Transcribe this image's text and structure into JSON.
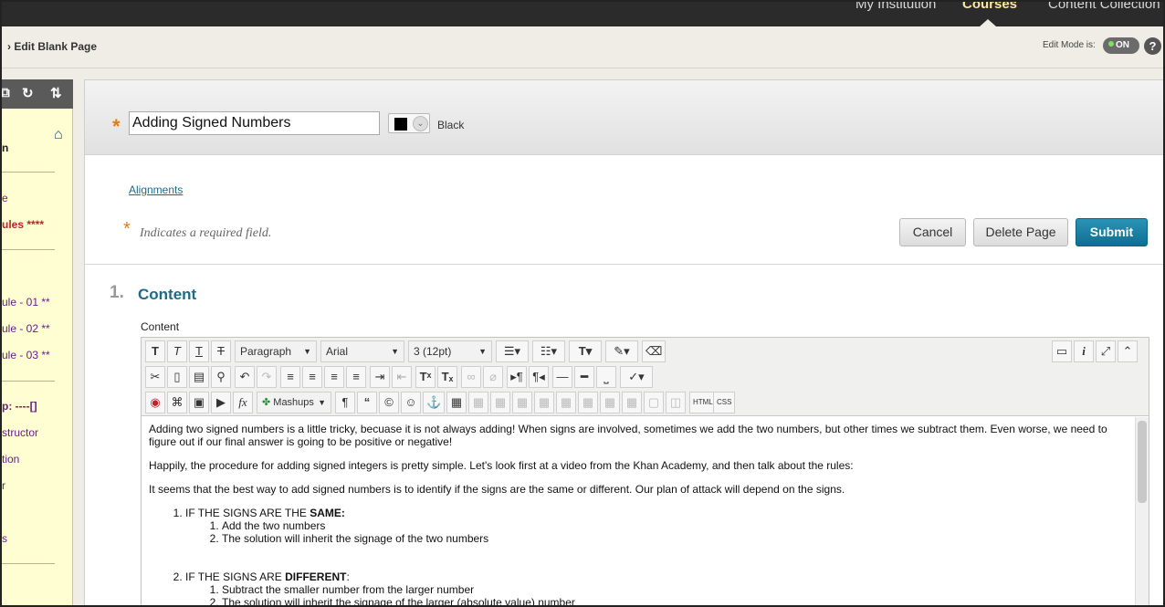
{
  "topnav": {
    "items": [
      "My Institution",
      "Courses",
      "Content Collection"
    ],
    "active": "Courses"
  },
  "breadcrumb": {
    "current": "Edit Blank Page"
  },
  "edit_mode": {
    "label": "Edit Mode is:",
    "state": "ON",
    "help": "?"
  },
  "sidebar": {
    "items": [
      "n",
      "e",
      "ules ****",
      "ule - 01 **",
      "ule - 02 **",
      "ule - 03 **",
      "p: ----[]",
      "structor",
      "tion",
      "r",
      "s"
    ]
  },
  "form": {
    "title_value": "Adding Signed Numbers",
    "color_label": "Black",
    "alignments_link": "Alignments",
    "required_note": "Indicates a required field.",
    "buttons": {
      "cancel": "Cancel",
      "delete": "Delete Page",
      "submit": "Submit"
    }
  },
  "section": {
    "number": "1.",
    "title": "Content",
    "field_label": "Content"
  },
  "editor": {
    "paragraph_select": "Paragraph",
    "font_select": "Arial",
    "size_select": "3 (12pt)",
    "mashups": "Mashups",
    "html_btn": "HTML",
    "css_btn": "CSS",
    "paragraphs": [
      "Adding two signed numbers is a little tricky, becuase it is not always adding! When signs are involved, sometimes we add the two numbers, but other times we subtract them. Even worse, we need to figure out if our final answer is going to be positive or negative!",
      "Happily, the procedure for adding signed integers is pretty simple. Let's look first at a video from the Khan Academy, and then talk about the rules:",
      "It seems that the best way to add signed numbers is to identify if the signs are the same or different. Our plan of attack will depend on the signs."
    ],
    "rule1": {
      "prefix": "IF THE SIGNS ARE THE ",
      "bold": "SAME:",
      "steps": [
        "Add the two numbers",
        "The solution will inherit the signage of the two numbers"
      ]
    },
    "rule2": {
      "prefix": "IF THE SIGNS ARE ",
      "bold": "DIFFERENT",
      "suffix": ":",
      "steps": [
        "Subtract the smaller number from the larger number",
        "The solution will inherit the signage of the larger (absolute value) number"
      ]
    }
  }
}
